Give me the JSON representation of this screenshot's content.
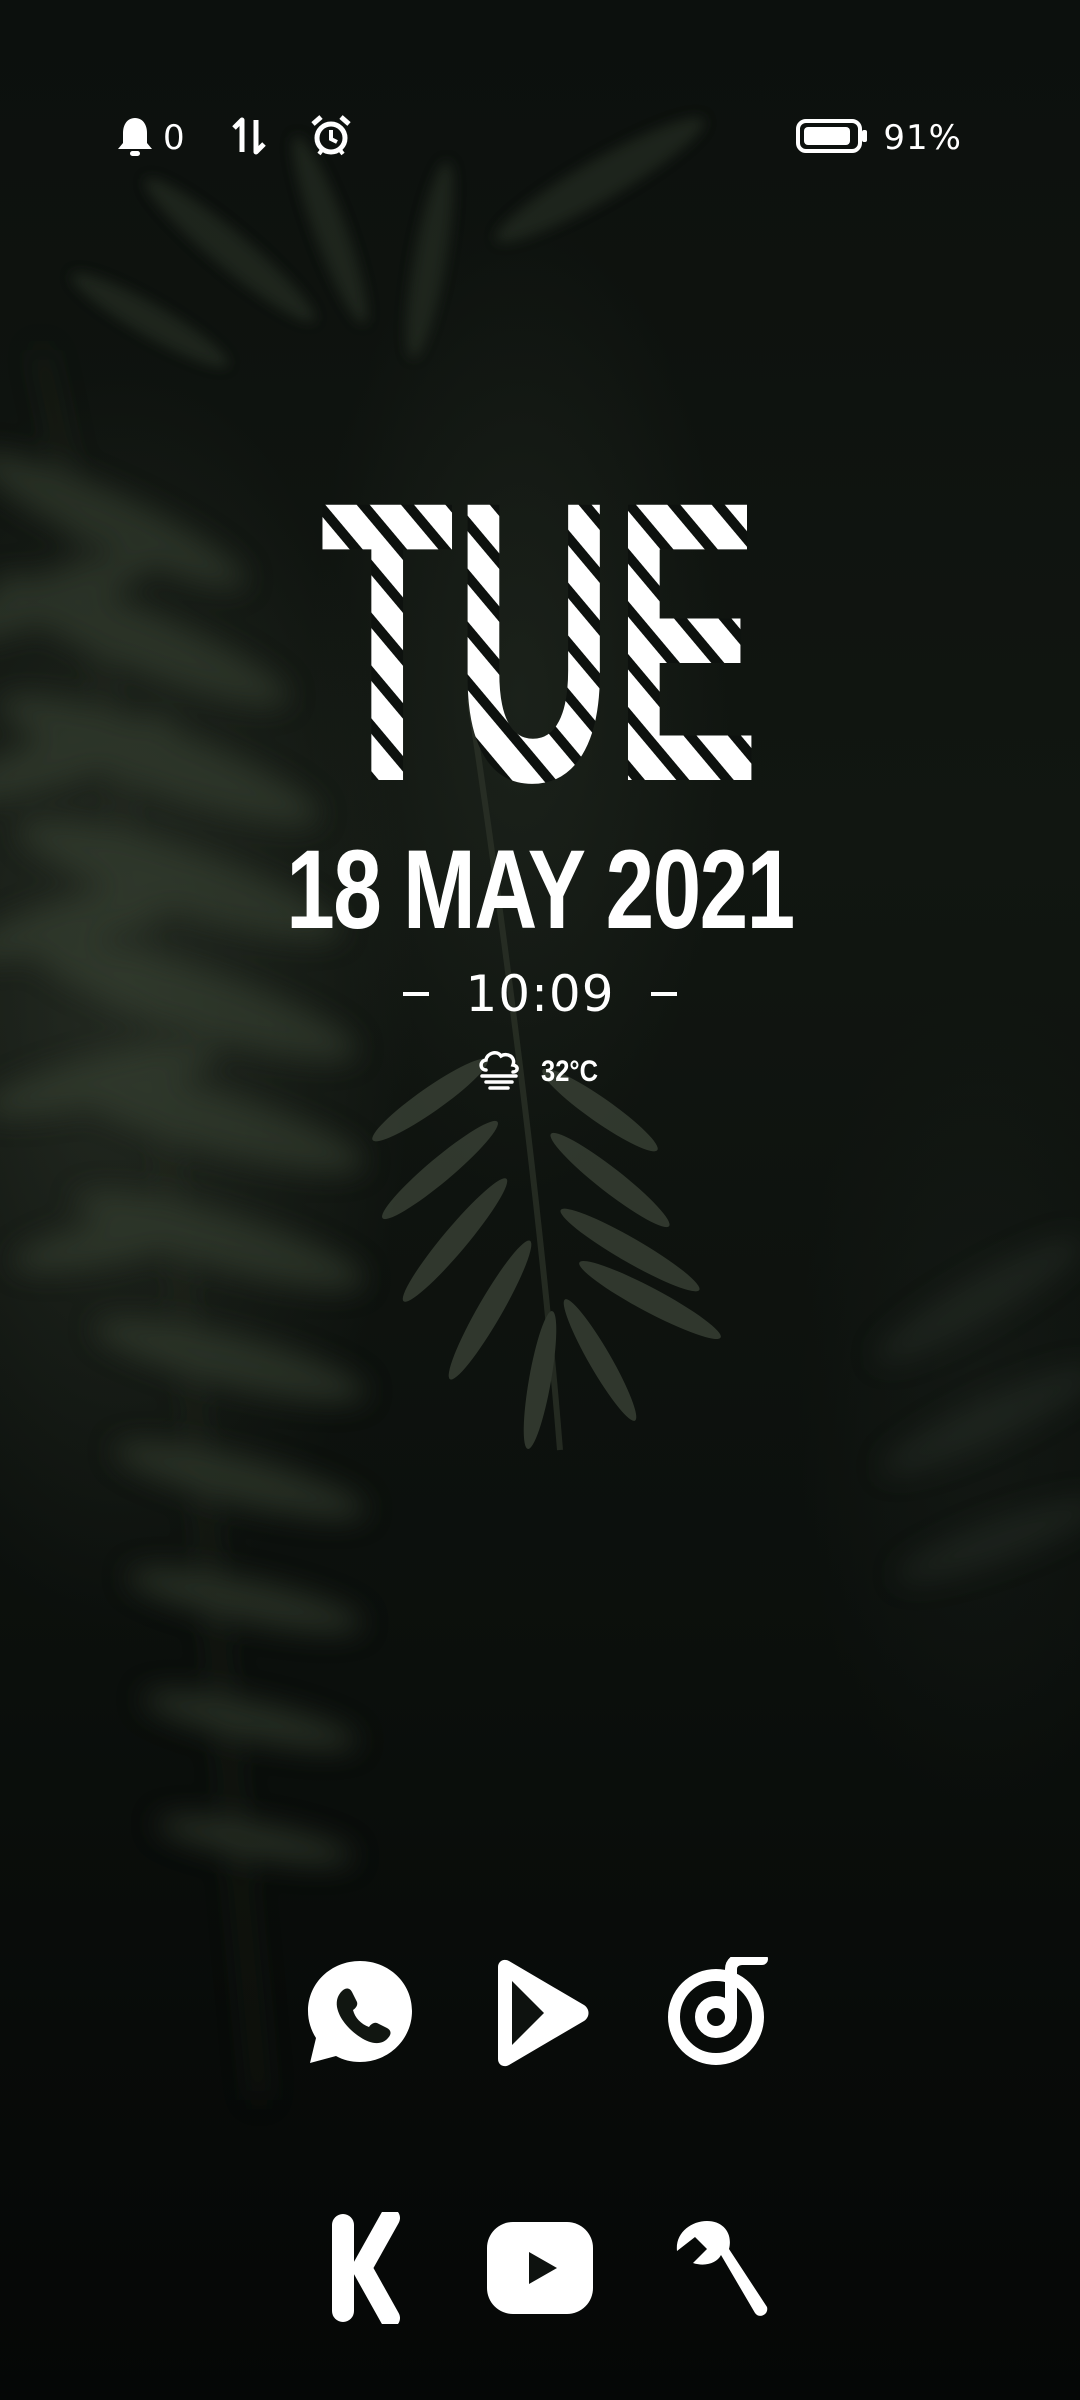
{
  "status_bar": {
    "notification_count": "0",
    "battery_percent": "91%",
    "icons": [
      "bell-icon",
      "data-transfer-icon",
      "alarm-icon",
      "battery-icon"
    ]
  },
  "clock_widget": {
    "day": "TUE",
    "date": "18 MAY 2021",
    "time": "10:09",
    "weather_icon": "fog-cloud-icon",
    "temperature": "32°C"
  },
  "home_apps": {
    "row1": [
      {
        "name": "whatsapp",
        "icon": "whatsapp-icon"
      },
      {
        "name": "play-store",
        "icon": "play-store-icon"
      },
      {
        "name": "music",
        "icon": "music-disc-icon"
      }
    ],
    "row2": [
      {
        "name": "kwgt",
        "icon": "k-logo-icon"
      },
      {
        "name": "youtube",
        "icon": "youtube-icon"
      },
      {
        "name": "settings-tools",
        "icon": "wrench-icon"
      }
    ]
  },
  "colors": {
    "foreground": "#ffffff",
    "background": "#0a0d0b",
    "leaf": "#2a3228"
  }
}
